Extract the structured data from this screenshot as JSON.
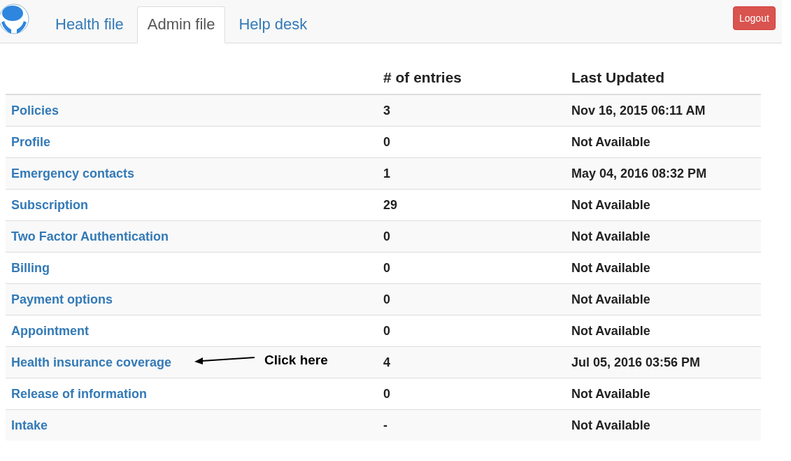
{
  "navbar": {
    "tabs": [
      {
        "label": "Health file",
        "selected": false
      },
      {
        "label": "Admin file",
        "selected": true
      },
      {
        "label": "Help desk",
        "selected": false
      }
    ],
    "logout": "Logout"
  },
  "table": {
    "columns": [
      "",
      "# of entries",
      "Last Updated"
    ],
    "rows": [
      {
        "name": "Policies",
        "entries": "3",
        "last_updated": "Nov 16, 2015 06:11 AM"
      },
      {
        "name": "Profile",
        "entries": "0",
        "last_updated": "Not Available"
      },
      {
        "name": "Emergency contacts",
        "entries": "1",
        "last_updated": "May 04, 2016 08:32 PM"
      },
      {
        "name": "Subscription",
        "entries": "29",
        "last_updated": "Not Available"
      },
      {
        "name": "Two Factor Authentication",
        "entries": "0",
        "last_updated": "Not Available"
      },
      {
        "name": "Billing",
        "entries": "0",
        "last_updated": "Not Available"
      },
      {
        "name": "Payment options",
        "entries": "0",
        "last_updated": "Not Available"
      },
      {
        "name": "Appointment",
        "entries": "0",
        "last_updated": "Not Available"
      },
      {
        "name": "Health insurance coverage",
        "entries": "4",
        "last_updated": "Jul 05, 2016 03:56 PM",
        "annotation": "Click here"
      },
      {
        "name": "Release of information",
        "entries": "0",
        "last_updated": "Not Available"
      },
      {
        "name": "Intake",
        "entries": "-",
        "last_updated": "Not Available"
      }
    ]
  }
}
